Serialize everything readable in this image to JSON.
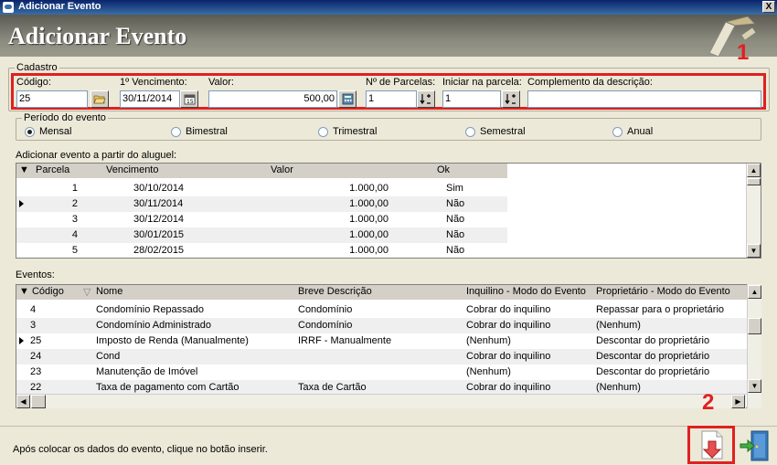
{
  "window": {
    "title": "Adicionar Evento",
    "close_label": "X"
  },
  "header": {
    "title": "Adicionar Evento"
  },
  "markers": {
    "one": "1",
    "two": "2"
  },
  "cadastro": {
    "legend": "Cadastro",
    "codigo": {
      "label": "Código:",
      "value": "25"
    },
    "vencimento": {
      "label": "1º Vencimento:",
      "value": "30/11/2014"
    },
    "valor": {
      "label": "Valor:",
      "value": "500,00"
    },
    "parcelas": {
      "label": "Nº de Parcelas:",
      "value": "1"
    },
    "iniciar": {
      "label": "Iniciar na parcela:",
      "value": "1"
    },
    "complemento": {
      "label": "Complemento da descrição:",
      "value": ""
    }
  },
  "periodo": {
    "legend": "Período do evento",
    "options": [
      "Mensal",
      "Bimestral",
      "Trimestral",
      "Semestral",
      "Anual"
    ],
    "selected": "Mensal"
  },
  "aluguel": {
    "label": "Adicionar evento a partir do aluguel:",
    "columns": [
      "Parcela",
      "Vencimento",
      "Valor",
      "Ok"
    ],
    "rows": [
      [
        "1",
        "30/10/2014",
        "1.000,00",
        "Sim"
      ],
      [
        "2",
        "30/11/2014",
        "1.000,00",
        "Não"
      ],
      [
        "3",
        "30/12/2014",
        "1.000,00",
        "Não"
      ],
      [
        "4",
        "30/01/2015",
        "1.000,00",
        "Não"
      ],
      [
        "5",
        "28/02/2015",
        "1.000,00",
        "Não"
      ]
    ],
    "current_row": 1
  },
  "eventos": {
    "label": "Eventos:",
    "columns": [
      "Código",
      "Nome",
      "Breve Descrição",
      "Inquilino - Modo do Evento",
      "Proprietário - Modo do Evento"
    ],
    "rows": [
      [
        "4",
        "Condomínio Repassado",
        "Condomínio",
        "Cobrar do inquilino",
        "Repassar para o proprietário"
      ],
      [
        "3",
        "Condomínio Administrado",
        "Condomínio",
        "Cobrar do inquilino",
        "(Nenhum)"
      ],
      [
        "25",
        "Imposto de Renda (Manualmente)",
        "IRRF - Manualmente",
        "(Nenhum)",
        "Descontar do proprietário"
      ],
      [
        "24",
        "Cond",
        "",
        "Cobrar do inquilino",
        "Descontar do proprietário"
      ],
      [
        "23",
        "Manutenção de Imóvel",
        "",
        "(Nenhum)",
        "Descontar do proprietário"
      ],
      [
        "22",
        "Taxa de pagamento com Cartão",
        "Taxa de Cartão",
        "Cobrar do inquilino",
        "(Nenhum)"
      ]
    ],
    "current_row": 2
  },
  "footer": {
    "hint": "Após colocar os dados do evento, clique no botão inserir."
  },
  "icons": {
    "folder": "folder-open-icon",
    "calendar": "calendar-icon",
    "calculator": "calculator-icon",
    "spin": "spin-icon",
    "insert": "insert-down-arrow-icon",
    "exit": "exit-door-icon"
  },
  "colors": {
    "highlight": "#e02020",
    "header_bg": "#7a7a6e"
  }
}
